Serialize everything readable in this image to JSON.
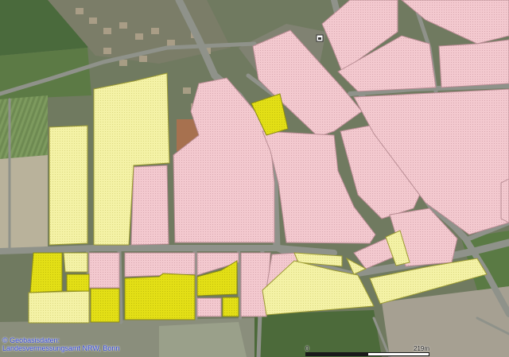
{
  "attribution": {
    "line1": "© Geobasisdaten:",
    "line2": "Landesvermessungsamt NRW, Bonn"
  },
  "scalebar": {
    "min_label": "0",
    "max_label": "219m"
  },
  "colors": {
    "residential": "#f3c9cf",
    "residential_edge": "#b98d94",
    "planned_light": "#f4f2a6",
    "planned_strong": "#e3df16",
    "planned_edge": "#9b9a32",
    "road": "#8c8f86",
    "field_green": "#4f6b3a",
    "field_pale": "#bdb6a2"
  },
  "legend_layers": [
    "residential-zone",
    "planned-zone-light",
    "planned-zone-strong",
    "road-network",
    "satellite-background"
  ]
}
